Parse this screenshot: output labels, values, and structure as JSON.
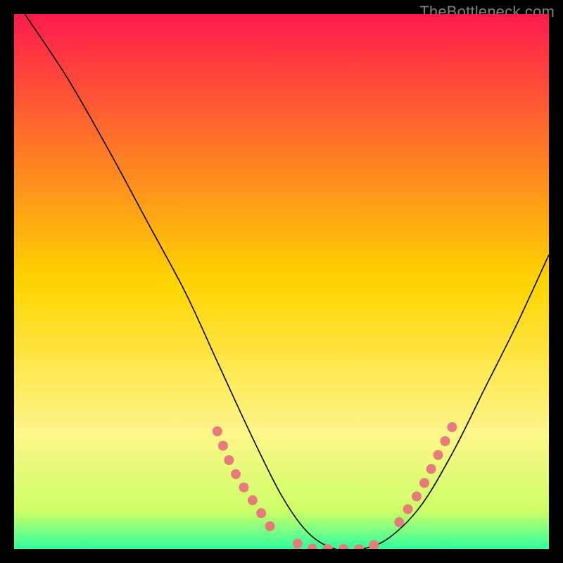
{
  "watermark": "TheBottleneck.com",
  "chart_data": {
    "type": "line",
    "title": "",
    "xlabel": "",
    "ylabel": "",
    "xlim": [
      0,
      100
    ],
    "ylim": [
      0,
      100
    ],
    "grid": false,
    "legend": false,
    "background_gradient": {
      "stops": [
        {
          "offset": 0.0,
          "color": "#ff1a4d"
        },
        {
          "offset": 0.5,
          "color": "#ffd400"
        },
        {
          "offset": 0.78,
          "color": "#fff68a"
        },
        {
          "offset": 0.93,
          "color": "#ccff66"
        },
        {
          "offset": 1.0,
          "color": "#2dff9e"
        }
      ]
    },
    "series": [
      {
        "name": "bottleneck-curve",
        "x": [
          2,
          10,
          18,
          25,
          32,
          38,
          44,
          50,
          55,
          60,
          65,
          70,
          76,
          82,
          88,
          94,
          100
        ],
        "y": [
          100,
          88,
          74,
          61,
          48,
          35,
          22,
          10,
          3,
          0,
          0,
          2,
          8,
          18,
          30,
          42,
          55
        ]
      }
    ],
    "highlighted_segments": [
      {
        "name": "left-shoulder-dots",
        "x": [
          38,
          40,
          42,
          44,
          46,
          48
        ],
        "y": [
          22,
          17,
          13,
          10,
          7,
          4
        ]
      },
      {
        "name": "valley-dots",
        "x": [
          53,
          56,
          59,
          62,
          65,
          68
        ],
        "y": [
          1,
          0,
          0,
          0,
          0,
          1
        ]
      },
      {
        "name": "right-shoulder-dots",
        "x": [
          72,
          74,
          76,
          78,
          80,
          82
        ],
        "y": [
          5,
          8,
          11,
          15,
          19,
          23
        ]
      }
    ]
  }
}
